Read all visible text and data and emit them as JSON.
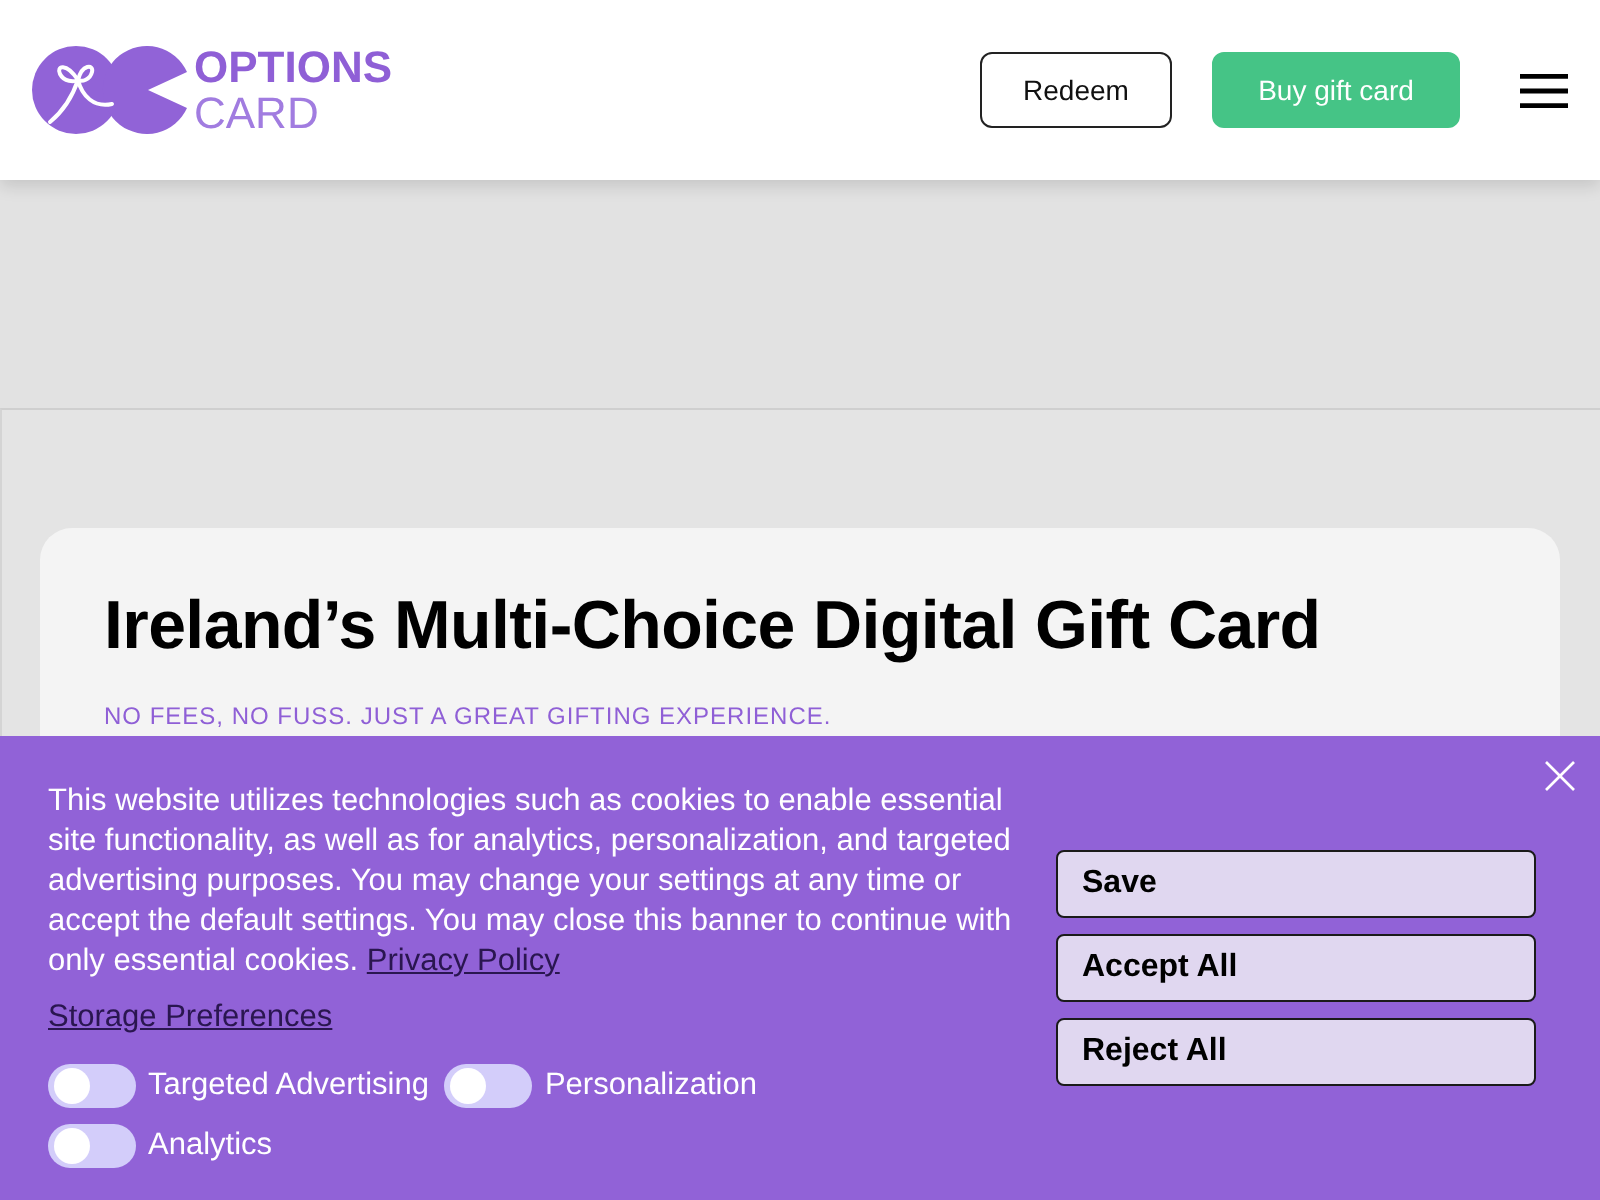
{
  "header": {
    "logo": {
      "line_1": "OPTIONS",
      "line_2": "CARD"
    },
    "buttons": [
      {
        "label": "Redeem",
        "kind": "outline"
      },
      {
        "label": "Buy gift card",
        "kind": "primary"
      }
    ]
  },
  "hero": {
    "title": "Ireland’s Multi-Choice Digital Gift Card",
    "subtitle": "NO FEES, NO FUSS. JUST A GREAT GIFTING EXPERIENCE."
  },
  "cookie_banner": {
    "text": "This website utilizes technologies such as cookies to enable essential site functionality, as well as for analytics, personalization, and targeted advertising purposes. You may change your settings at any time or accept the default settings. You may close this banner to continue with only essential cookies.",
    "privacy_link": "Privacy Policy",
    "preferences_link": "Storage Preferences",
    "toggles": [
      {
        "label": "Targeted Advertising",
        "on": false
      },
      {
        "label": "Personalization",
        "on": false
      },
      {
        "label": "Analytics",
        "on": false
      }
    ],
    "buttons": [
      "Save",
      "Accept All",
      "Reject All"
    ]
  }
}
